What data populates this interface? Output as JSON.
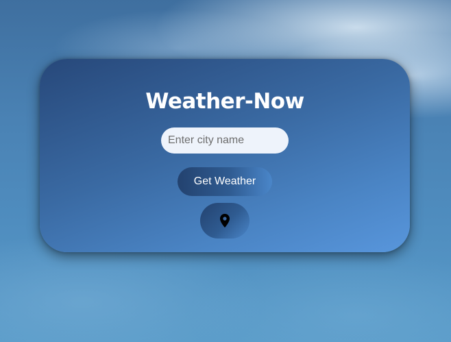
{
  "app": {
    "title": "Weather-Now"
  },
  "search": {
    "placeholder": "Enter city name",
    "value": ""
  },
  "actions": {
    "get_weather_label": "Get Weather",
    "location_icon": "map-pin-icon"
  },
  "colors": {
    "card_gradient_start": "#27487a",
    "card_gradient_end": "#5896dc",
    "button_dark": "#23426f",
    "title_text": "#ffffff",
    "input_background": "#eef3fb"
  }
}
